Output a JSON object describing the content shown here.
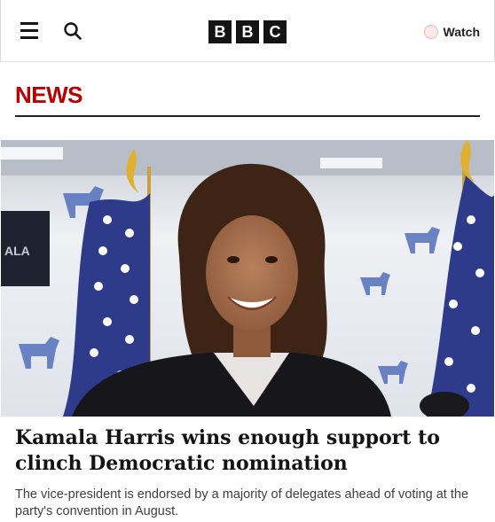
{
  "header": {
    "logo_letters": [
      "B",
      "B",
      "C"
    ],
    "watch_label": "Watch",
    "menu_icon": "hamburger-icon",
    "search_icon": "search-icon"
  },
  "section": {
    "title": "NEWS",
    "accent_color": "#b80000"
  },
  "article": {
    "image_subject": "Kamala Harris smiling in front of US flags",
    "headline": "Kamala Harris wins enough support to clinch Democratic nomination",
    "summary": "The vice-president is endorsed by a majority of delegates ahead of voting at the party's convention in August."
  }
}
